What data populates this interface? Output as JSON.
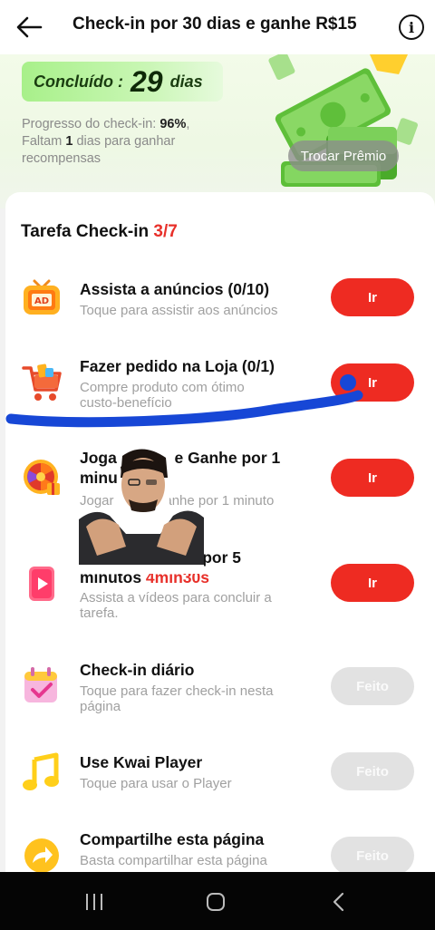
{
  "header": {
    "title": "Check-in por 30 dias e ganhe R$15",
    "info_symbol": "i"
  },
  "hero": {
    "done_label": "Concluído :",
    "done_days": "29",
    "done_unit": "dias",
    "progress_prefix": "Progresso do check-in: ",
    "progress_value": "96%",
    "progress_suffix": ",",
    "remaining_prefix": "Faltam ",
    "remaining_value": "1",
    "remaining_suffix": " dias para ganhar recompensas",
    "trade_button": "Trocar Prêmio"
  },
  "tasks_header": {
    "label": "Tarefa Check-in ",
    "count": "3/7"
  },
  "tasks": [
    {
      "title": "Assista a anúncios  (0/10)",
      "subtitle": "Toque para assistir aos anúncios",
      "button": "Ir",
      "icon": "ad-tv-icon"
    },
    {
      "title": "Fazer pedido na Loja  (0/1)",
      "subtitle": "Compre produto com ótimo custo-benefício",
      "button": "Ir",
      "icon": "shopping-cart-icon"
    },
    {
      "title_a": "Jogar",
      "title_b": "e Ganhe por 1",
      "title_c": "minu",
      "subtitle_a": "Jogar",
      "subtitle_b": "Ganhe por 1 minuto",
      "button": "Ir",
      "icon": "prize-wheel-icon"
    },
    {
      "title_a": "A",
      "title_b": "s por 5",
      "title_c": "minutos ",
      "timer": "4min30s",
      "subtitle": "Assista a vídeos para concluir a tarefa.",
      "button": "Ir",
      "icon": "video-play-icon"
    },
    {
      "title": "Check-in diário",
      "subtitle": "Toque para fazer check-in nesta página",
      "button": "Feito",
      "icon": "calendar-check-icon"
    },
    {
      "title": "Use Kwai Player",
      "subtitle": "Toque para usar o Player",
      "button": "Feito",
      "icon": "music-note-icon"
    },
    {
      "title": "Compartilhe esta página",
      "subtitle": "Basta compartilhar esta página",
      "button": "Feito",
      "icon": "share-arrow-icon"
    }
  ],
  "colors": {
    "accent_red": "#ee2b22",
    "done_gray": "#e2e2e2",
    "badge_green": "#a8f08a",
    "scribble_blue": "#1747d6"
  },
  "navbar": {
    "recent_icon": "recent-apps-icon",
    "home_icon": "home-icon",
    "back_icon": "back-nav-icon"
  }
}
